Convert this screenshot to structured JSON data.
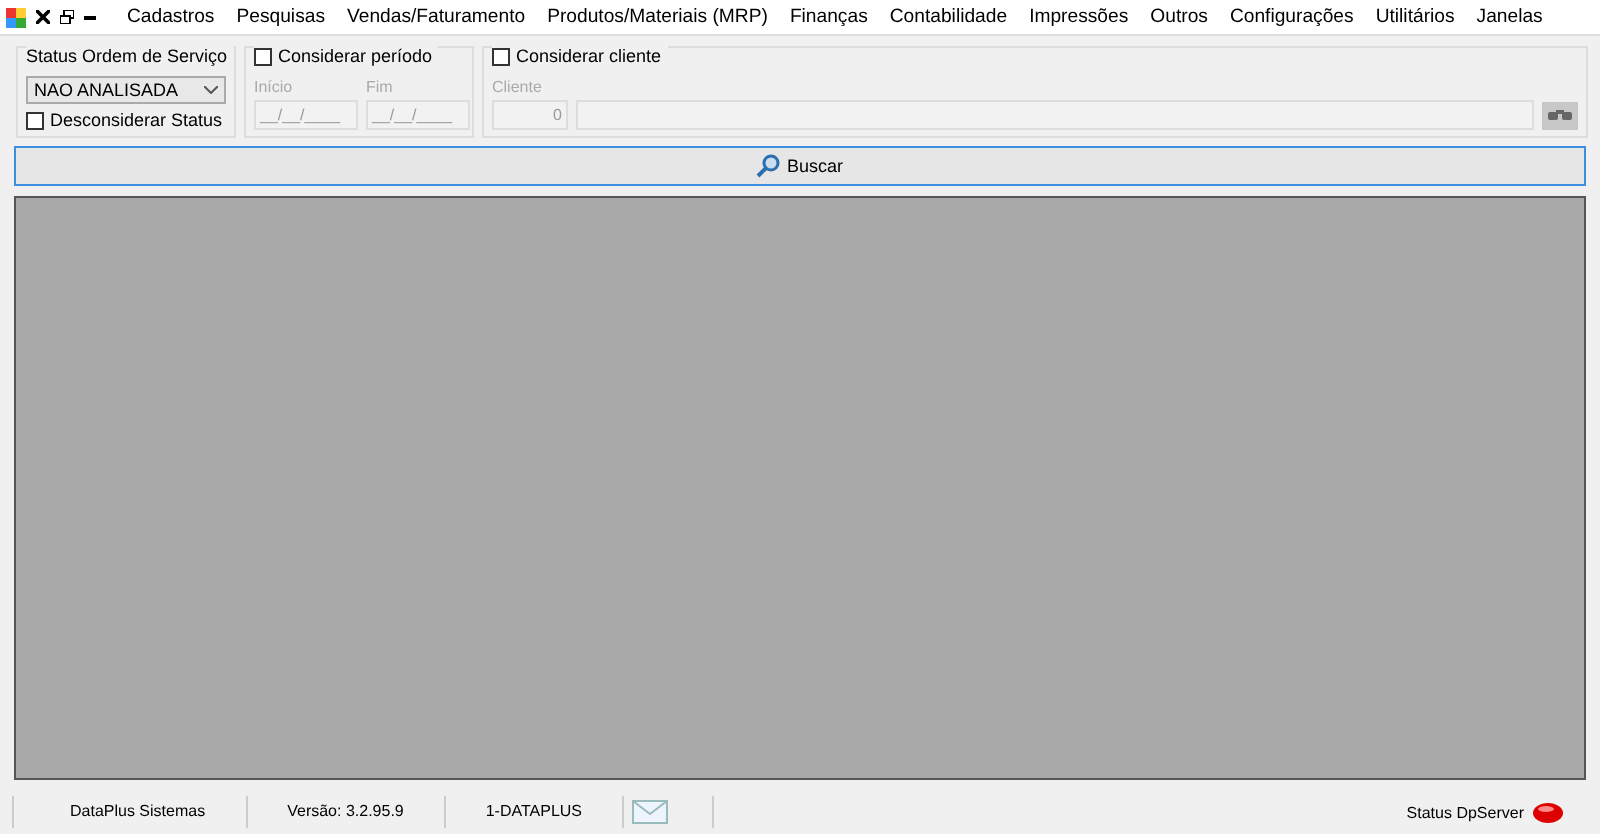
{
  "menu": {
    "items": [
      "Cadastros",
      "Pesquisas",
      "Vendas/Faturamento",
      "Produtos/Materiais (MRP)",
      "Finanças",
      "Contabilidade",
      "Impressões",
      "Outros",
      "Configurações",
      "Utilitários",
      "Janelas"
    ]
  },
  "status_group": {
    "title": "Status Ordem de Serviço",
    "value": "NAO ANALISADA",
    "ignore": {
      "label": "Desconsiderar Status",
      "checked": false
    }
  },
  "period_group": {
    "label": "Considerar período",
    "checked": false,
    "disabled": true,
    "fields": [
      {
        "label": "Início",
        "value": "__/__/____"
      },
      {
        "label": "Fim",
        "value": "__/__/____"
      }
    ]
  },
  "client_group": {
    "label": "Considerar cliente",
    "checked": false,
    "disabled": true,
    "field_label": "Cliente",
    "code": "0"
  },
  "search_button": {
    "label": "Buscar"
  },
  "status_bar": {
    "items": [
      "DataPlus Sistemas",
      "Versão: 3.2.95.9",
      "1-DATAPLUS"
    ],
    "server_label": "Status DpServer"
  }
}
